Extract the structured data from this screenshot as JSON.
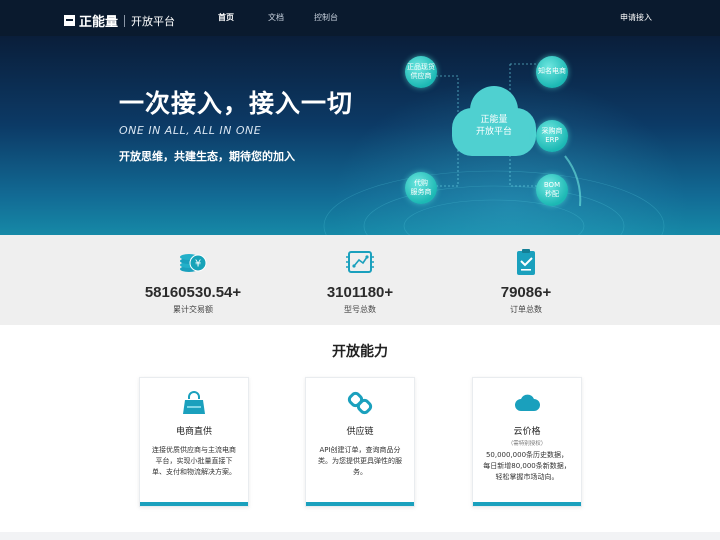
{
  "nav": {
    "logo_text": "正能量",
    "logo_sub": "开放平台",
    "items": [
      {
        "label": "首页",
        "active": true
      },
      {
        "label": "文档",
        "active": false
      },
      {
        "label": "控制台",
        "active": false
      }
    ],
    "apply_label": "申请接入"
  },
  "hero": {
    "title": "一次接入，接入一切",
    "subtitle_en": "ONE IN ALL, ALL IN ONE",
    "slogan": "开放思维，共建生态，期待您的加入",
    "center_node": {
      "line1": "正能量",
      "line2": "开放平台"
    },
    "nodes": [
      {
        "line1": "正品现货",
        "line2": "供应商"
      },
      {
        "line1": "知名电商",
        "line2": ""
      },
      {
        "line1": "采购商",
        "line2": "ERP"
      },
      {
        "line1": "BOM",
        "line2": "秒配"
      },
      {
        "line1": "代购",
        "line2": "服务商"
      }
    ]
  },
  "stats": [
    {
      "value": "58160530.54+",
      "label": "累计交易额",
      "icon": "coins-yen-icon"
    },
    {
      "value": "3101180+",
      "label": "型号总数",
      "icon": "chip-board-icon"
    },
    {
      "value": "79086+",
      "label": "订单总数",
      "icon": "order-clipboard-icon"
    }
  ],
  "capabilities": {
    "title": "开放能力",
    "cards": [
      {
        "title": "电商直供",
        "note": "",
        "desc": "连接优质供应商与主流电商平台，实现小批量直接下单、支付和物流解决方案。",
        "icon": "shopping-bag-icon"
      },
      {
        "title": "供应链",
        "note": "",
        "desc": "API创建订单，查询商品分类。为您提供更具弹性的服务。",
        "icon": "chain-link-icon"
      },
      {
        "title": "云价格",
        "note": "（需特别授权）",
        "desc": "50,000,000条历史数据，每日新增80,000条新数据，轻松掌握市场动向。",
        "icon": "cloud-icon"
      }
    ]
  },
  "colors": {
    "nav_bg": "#0a1a2e",
    "accent": "#1aa0bd",
    "node": "#1cb8b4"
  }
}
